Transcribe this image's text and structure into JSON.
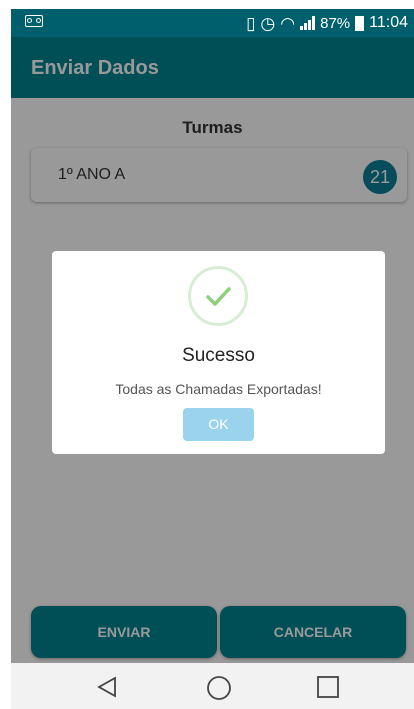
{
  "status_bar": {
    "battery": "87%",
    "time": "11:04"
  },
  "app_bar": {
    "title": "Enviar Dados"
  },
  "main": {
    "section_title": "Turmas",
    "classes": [
      {
        "name": "1º ANO A",
        "count": "21"
      }
    ],
    "buttons": {
      "send": "ENVIAR",
      "cancel": "CANCELAR"
    }
  },
  "dialog": {
    "title": "Sucesso",
    "message": "Todas as Chamadas Exportadas!",
    "ok": "OK"
  },
  "colors": {
    "primary": "#00838f",
    "status_bar": "#005f6d",
    "success": "#8fd07f",
    "ok_button": "#9ad3eb"
  }
}
